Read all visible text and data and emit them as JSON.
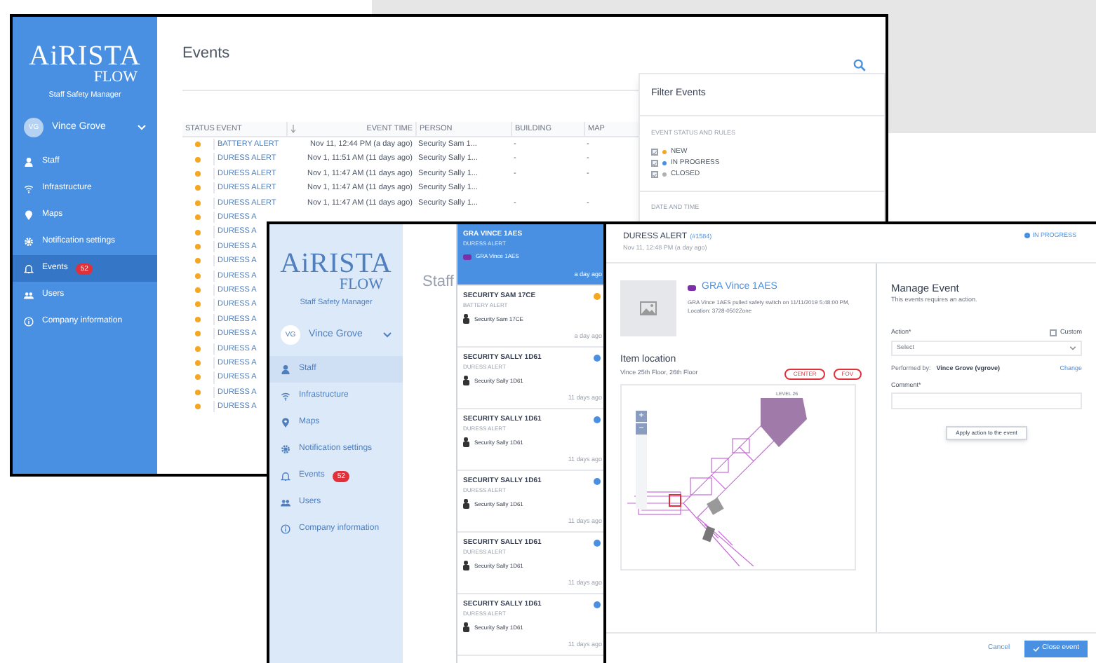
{
  "events_window": {
    "logo": {
      "brand": "AiRISTA",
      "sub": "FLOW",
      "tagline": "Staff Safety Manager"
    },
    "user": {
      "initials": "VG",
      "name": "Vince Grove"
    },
    "sidebar": {
      "items": [
        {
          "label": "Staff",
          "kind": "person",
          "selected": false
        },
        {
          "label": "Infrastructure",
          "kind": "wifi",
          "selected": false
        },
        {
          "label": "Maps",
          "kind": "pin",
          "selected": false
        },
        {
          "label": "Notification settings",
          "kind": "gear",
          "selected": false
        },
        {
          "label": "Events",
          "kind": "bell",
          "badge": "52",
          "selected": true
        },
        {
          "label": "Users",
          "kind": "users",
          "selected": false
        },
        {
          "label": "Company information",
          "kind": "info",
          "selected": false
        }
      ]
    },
    "title": "Events",
    "table": {
      "columns": [
        "STATUS",
        "EVENT",
        "EVENT TIME",
        "PERSON",
        "BUILDING",
        "MAP"
      ],
      "rows": [
        {
          "color": "#f5a623",
          "event": "BATTERY ALERT",
          "time": "Nov 11, 12:44 PM (a day ago)",
          "person": "Security Sam 1...",
          "building": "-",
          "map": "-"
        },
        {
          "color": "#f5a623",
          "event": "DURESS ALERT",
          "time": "Nov 1, 11:51 AM (11 days ago)",
          "person": "Security Sally 1...",
          "building": "-",
          "map": "-"
        },
        {
          "color": "#f5a623",
          "event": "DURESS ALERT",
          "time": "Nov 1, 11:47 AM (11 days ago)",
          "person": "Security Sally 1...",
          "building": "-",
          "map": "-"
        },
        {
          "color": "#f5a623",
          "event": "DURESS ALERT",
          "time": "Nov 1, 11:47 AM (11 days ago)",
          "person": "Security Sally 1..."
        },
        {
          "color": "#f5a623",
          "event": "DURESS ALERT",
          "time": "Nov 1, 11:47 AM (11 days ago)",
          "person": "Security Sally 1...",
          "building": "-",
          "map": "-"
        },
        {
          "color": "#f5a623",
          "event": "DURESS A"
        },
        {
          "color": "#f5a623",
          "event": "DURESS A"
        },
        {
          "color": "#f5a623",
          "event": "DURESS A"
        },
        {
          "color": "#f5a623",
          "event": "DURESS A"
        },
        {
          "color": "#f5a623",
          "event": "DURESS A"
        },
        {
          "color": "#f5a623",
          "event": "DURESS A"
        },
        {
          "color": "#f5a623",
          "event": "DURESS A"
        },
        {
          "color": "#f5a623",
          "event": "DURESS A"
        },
        {
          "color": "#f5a623",
          "event": "DURESS A"
        },
        {
          "color": "#f5a623",
          "event": "DURESS A"
        },
        {
          "color": "#f5a623",
          "event": "DURESS A"
        },
        {
          "color": "#f5a623",
          "event": "DURESS A"
        },
        {
          "color": "#f5a623",
          "event": "DURESS A"
        },
        {
          "color": "#f5a623",
          "event": "DURESS A"
        }
      ]
    }
  },
  "filter_popup": {
    "title": "Filter Events",
    "section": "EVENT STATUS AND RULES",
    "options": [
      {
        "label": "NEW",
        "color": "#f5a623",
        "checked": true
      },
      {
        "label": "IN PROGRESS",
        "color": "#4a90e2",
        "checked": true
      },
      {
        "label": "CLOSED",
        "color": "#b0b0b0",
        "checked": true
      }
    ],
    "section_2": "DATE AND TIME"
  },
  "staff_window": {
    "logo": {
      "brand": "AiRISTA",
      "sub": "FLOW",
      "tagline": "Staff Safety Manager"
    },
    "user": {
      "initials": "VG",
      "name": "Vince Grove"
    },
    "sidebar": {
      "items": [
        {
          "label": "Staff",
          "kind": "person",
          "selected": true
        },
        {
          "label": "Infrastructure",
          "kind": "wifi",
          "selected": false
        },
        {
          "label": "Maps",
          "kind": "pin",
          "selected": false
        },
        {
          "label": "Notification settings",
          "kind": "gear",
          "selected": false
        },
        {
          "label": "Events",
          "kind": "bell",
          "badge": "52",
          "selected": false
        },
        {
          "label": "Users",
          "kind": "users",
          "selected": false
        },
        {
          "label": "Company information",
          "kind": "info",
          "selected": false
        }
      ]
    },
    "title": "Staff",
    "event_list": [
      {
        "title": "GRA VINCE 1AES",
        "type": "DURESS ALERT",
        "person": "GRA Vince 1AES",
        "time": "a day ago",
        "selected": true,
        "kind": "tag"
      },
      {
        "title": "SECURITY SAM 17CE",
        "type": "BATTERY ALERT",
        "person": "Security Sam 17CE",
        "time": "a day ago",
        "selected": false,
        "color": "#f5a623",
        "kind": "badge"
      },
      {
        "title": "SECURITY SALLY 1D61",
        "type": "DURESS ALERT",
        "person": "Security Sally 1D61",
        "time": "11 days ago",
        "selected": false,
        "color": "#4a90e2",
        "kind": "badge"
      },
      {
        "title": "SECURITY SALLY 1D61",
        "type": "DURESS ALERT",
        "person": "Security Sally 1D61",
        "time": "11 days ago",
        "selected": false,
        "color": "#4a90e2",
        "kind": "badge"
      },
      {
        "title": "SECURITY SALLY 1D61",
        "type": "DURESS ALERT",
        "person": "Security Sally 1D61",
        "time": "11 days ago",
        "selected": false,
        "color": "#4a90e2",
        "kind": "badge"
      },
      {
        "title": "SECURITY SALLY 1D61",
        "type": "DURESS ALERT",
        "person": "Security Sally 1D61",
        "time": "11 days ago",
        "selected": false,
        "color": "#4a90e2",
        "kind": "badge"
      },
      {
        "title": "SECURITY SALLY 1D61",
        "type": "DURESS ALERT",
        "person": "Security Sally 1D61",
        "time": "11 days ago",
        "selected": false,
        "color": "#4a90e2",
        "kind": "badge"
      }
    ]
  },
  "event_detail": {
    "title": "DURESS ALERT",
    "id": "(#1584)",
    "date": "Nov 11, 12:48 PM (a day ago)",
    "status": "IN PROGRESS",
    "person": "GRA Vince 1AES",
    "description": "GRA Vince 1AES pulled safety switch on 11/11/2019 5:48:00 PM, Location: 3728-0502Zone",
    "location_title": "Item location",
    "location": "Vince 25th Floor, 26th Floor",
    "location_buttons": [
      "CENTER",
      "FOV"
    ],
    "map": {
      "label": "LEVEL 26",
      "zoom_in": "+",
      "zoom_out": "−"
    },
    "manage": {
      "title": "Manage Event",
      "subtitle": "This events requires an action.",
      "action_label": "Action*",
      "custom_label": "Custom",
      "custom_checked": false,
      "select": "Select",
      "performed_label": "Performed by:",
      "performed_by": "Vince Grove (vgrove)",
      "change": "Change",
      "comment_label": "Comment*",
      "apply": "Apply action to the event"
    },
    "footer": {
      "cancel": "Cancel",
      "close": "Close event"
    }
  }
}
